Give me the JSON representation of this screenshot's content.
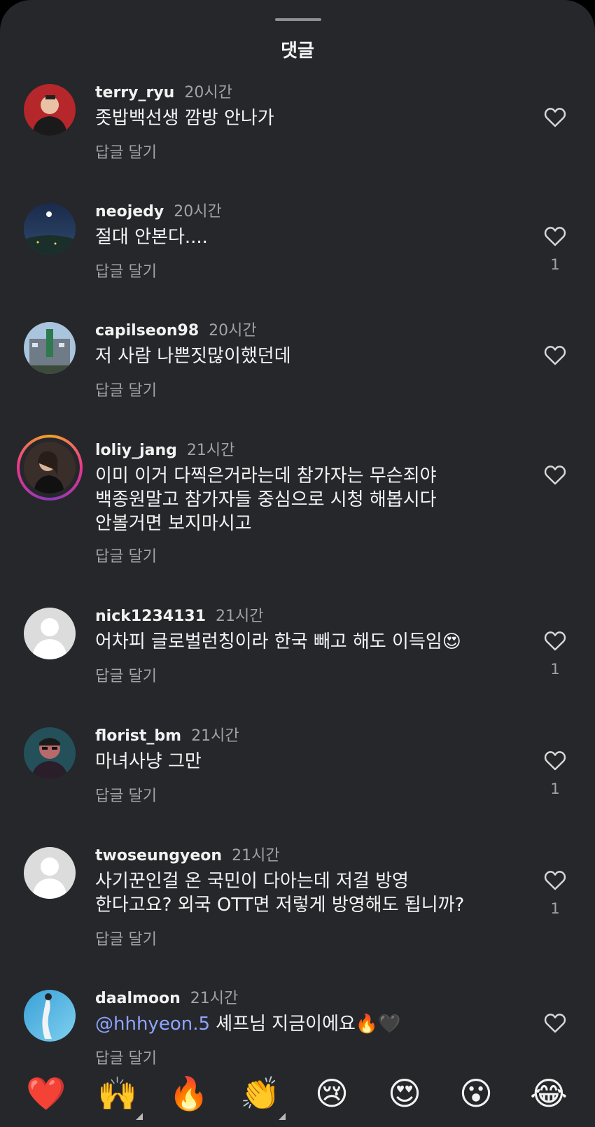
{
  "header": {
    "title": "댓글"
  },
  "reply_label": "답글 달기",
  "comments": [
    {
      "username": "terry_ryu",
      "time": "20시간",
      "text": "좃밥백선생 깜방 안나가",
      "likes": ""
    },
    {
      "username": "neojedy",
      "time": "20시간",
      "text": "절대 안본다....",
      "likes": "1"
    },
    {
      "username": "capilseon98",
      "time": "20시간",
      "text": "저 사람 나쁜짓많이했던데",
      "likes": ""
    },
    {
      "username": "loliy_jang",
      "time": "21시간",
      "text": "이미 이거 다찍은거라는데 참가자는 무슨죄야\n백종원말고 참가자들 중심으로 시청 해봅시다\n안볼거면 보지마시고",
      "likes": ""
    },
    {
      "username": "nick1234131",
      "time": "21시간",
      "text": "어차피 글로벌런칭이라 한국 빼고 해도 이득임😍",
      "likes": "1"
    },
    {
      "username": "florist_bm",
      "time": "21시간",
      "text": "마녀사냥 그만",
      "likes": "1"
    },
    {
      "username": "twoseungyeon",
      "time": "21시간",
      "text": "사기꾼인걸 온 국민이 다아는데 저걸 방영\n한다고요? 외국 OTT면 저렇게 방영해도 됩니까?",
      "likes": "1"
    },
    {
      "username": "daalmoon",
      "time": "21시간",
      "mention": "@hhhyeon.5",
      "text": " 셰프님 지금이에요🔥🖤",
      "likes": ""
    }
  ],
  "emoji_bar": [
    "❤️",
    "🙌",
    "🔥",
    "👏",
    "😢",
    "😍",
    "😮",
    "😂"
  ],
  "colors": {
    "background": "#25272b",
    "text": "#f2f2f2",
    "muted": "#a2a3a7",
    "mention": "#8fa4ff"
  }
}
